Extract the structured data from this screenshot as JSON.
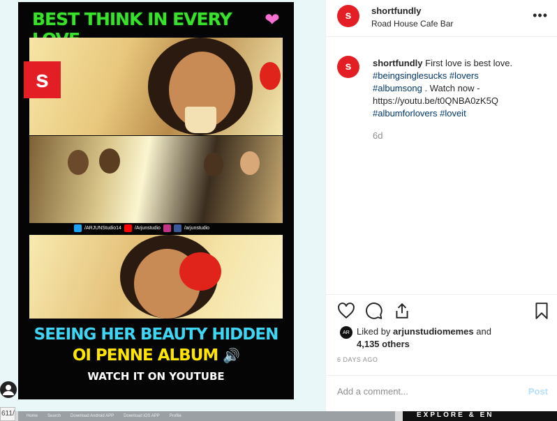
{
  "post_image": {
    "title": "BEST THINK IN EVERY LOVE",
    "logo_letter": "s",
    "social_handles": [
      "/ARJUNStudio14",
      "/Arjunstudio",
      "/arjunstudio"
    ],
    "caption_line1": "SEEING HER BEAUTY HIDDEN",
    "caption_line2": "OI PENNE ALBUM",
    "caption_line3": "WATCH IT ON YOUTUBE"
  },
  "header": {
    "username": "shortfundly",
    "location": "Road House Cafe Bar",
    "more_label": "•••"
  },
  "caption": {
    "username": "shortfundly",
    "text": "First love is best love.",
    "tags1": "#beingsinglesucks #lovers",
    "tags2": "#albumsong",
    "watch": ". Watch now -",
    "link": "https://youtu.be/t0QNBA0zK5Q",
    "tags3": "#albumforlovers #loveit",
    "age": "6d"
  },
  "likes": {
    "prefix": "Liked by",
    "user": "arjunstudiomemes",
    "and": "and",
    "others": "4,135 others",
    "avatar_text": "AR"
  },
  "date": "6 DAYS AGO",
  "comment": {
    "placeholder": "Add a comment...",
    "post_label": "Post"
  },
  "bottom_bar": {
    "items": [
      "Home",
      "Search",
      "Download Android APP",
      "Download iOS APP",
      "Profile"
    ],
    "explore_text": "EXPLORE & EN"
  },
  "url_fragment": "611/",
  "colors": {
    "brand_red": "#e31e24",
    "hashtag": "#00376b",
    "title_green": "#39e12c",
    "caption_cyan": "#3dd7f5",
    "caption_yellow": "#ffe500"
  }
}
